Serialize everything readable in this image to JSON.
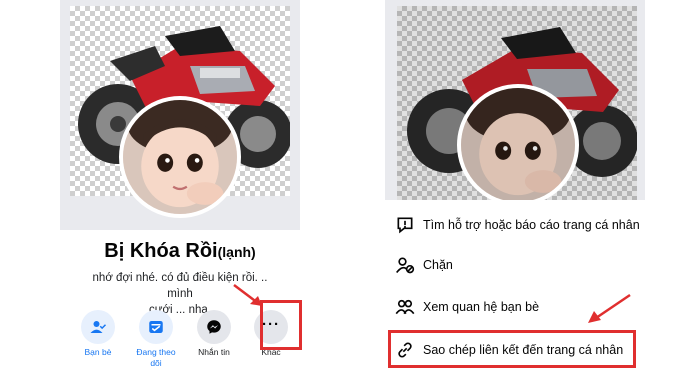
{
  "left_screen": {
    "profile": {
      "name": "Bị Khóa Rồi",
      "name_suffix": "(lạnh)",
      "bio_line1": "nhớ đợi nhé. có đủ điều kiện rồi. .. mình",
      "bio_line2": "cưới ... nha."
    },
    "actions": [
      {
        "label": "Bạn bè",
        "icon": "friends-check-icon"
      },
      {
        "label": "Đang theo dõi",
        "icon": "following-feed-icon"
      },
      {
        "label": "Nhắn tin",
        "icon": "messenger-icon"
      },
      {
        "label": "Khác",
        "icon": "more-dots-icon"
      }
    ],
    "more_glyph": "···"
  },
  "right_screen": {
    "menu_items": [
      {
        "label": "Tìm hỗ trợ hoặc báo cáo trang cá nhân",
        "icon": "report-icon"
      },
      {
        "label": "Chặn",
        "icon": "block-user-icon"
      },
      {
        "label": "Xem quan hệ bạn bè",
        "icon": "friendship-icon"
      },
      {
        "label": "Sao chép liên kết đến trang cá nhân",
        "icon": "link-icon"
      }
    ]
  },
  "colors": {
    "accent_blue": "#1877f2",
    "annotation_red": "#e02f2f",
    "motorbike_red": "#c8202a"
  }
}
